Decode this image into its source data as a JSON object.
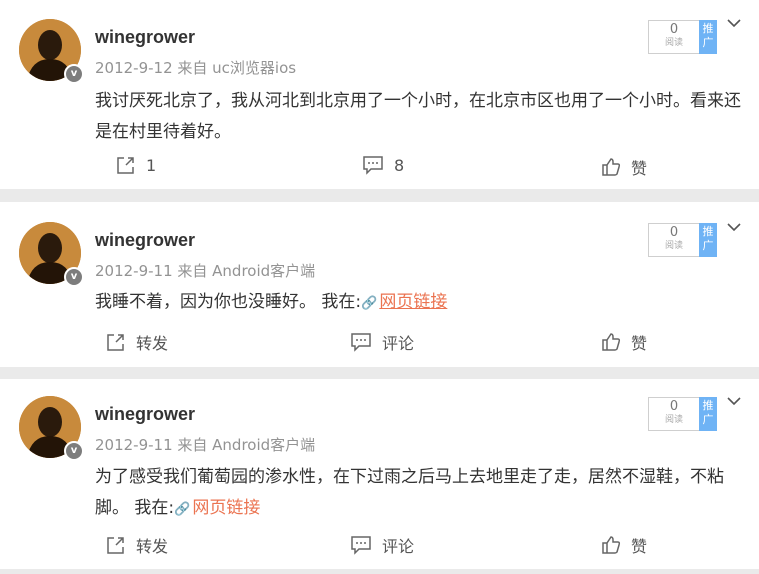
{
  "posts": [
    {
      "username": "winegrower",
      "meta": "2012-9-12 来自 uc浏览器ios",
      "content": "我讨厌死北京了，我从河北到北京用了一个小时，在北京市区也用了一个小时。看来还是在村里待着好。",
      "link": "",
      "reads": "0",
      "reads_label": "阅读",
      "push_label": "推广",
      "repost": "1",
      "comment": "8",
      "like": "赞"
    },
    {
      "username": "winegrower",
      "meta": "2012-9-11 来自 Android客户端",
      "content": "我睡不着，因为你也没睡好。 我在:",
      "link": "网页链接",
      "reads": "0",
      "reads_label": "阅读",
      "push_label": "推广",
      "repost": "转发",
      "comment": "评论",
      "like": "赞"
    },
    {
      "username": "winegrower",
      "meta": "2012-9-11 来自 Android客户端",
      "content": "为了感受我们葡萄园的渗水性，在下过雨之后马上去地里走了走，居然不湿鞋，不粘脚。 我在:",
      "link": "网页链接",
      "reads": "0",
      "reads_label": "阅读",
      "push_label": "推广",
      "repost": "转发",
      "comment": "评论",
      "like": "赞"
    }
  ],
  "verified_badge": "v",
  "icons": [
    "repost-icon",
    "comment-icon",
    "like-icon",
    "link-icon",
    "chevron-down-icon"
  ]
}
